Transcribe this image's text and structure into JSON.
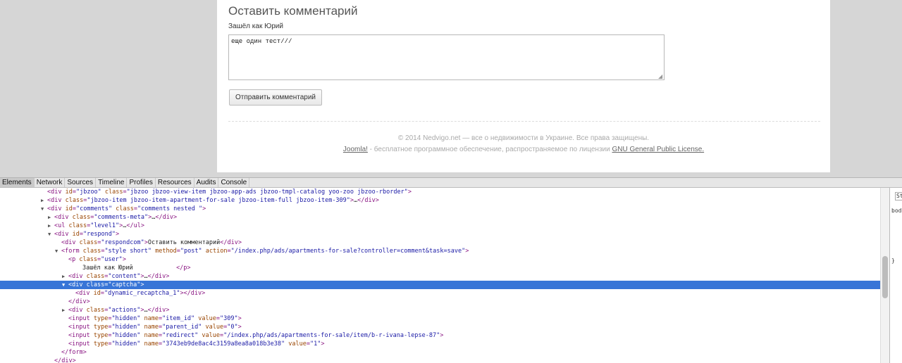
{
  "page": {
    "comment_title": "Оставить комментарий",
    "logged_as": "Зашёл как Юрий",
    "comment_text": "еще один тест///",
    "submit_label": "Отправить комментарий",
    "copyright": "© 2014 Nedvigo.net — все о недвижимости в Украине. Все права защищены.",
    "license_link_joomla": "Joomla!",
    "license_middle": " - бесплатное программное обеспечение, распространяемое по лицензии ",
    "license_link_gnu": "GNU General Public License."
  },
  "devtools": {
    "tabs": [
      "Elements",
      "Network",
      "Sources",
      "Timeline",
      "Profiles",
      "Resources",
      "Audits",
      "Console"
    ],
    "active_tab": "Elements",
    "lines": [
      {
        "indent": 6,
        "tri": "",
        "html": "<div id=\"jbzoo\" class=\"jbzoo jbzoo-view-item jbzoo-app-ads jbzoo-tmpl-catalog yoo-zoo jbzoo-rborder\">",
        "cut": true
      },
      {
        "indent": 6,
        "tri": "▶",
        "html": "<div class=\"jbzoo-item jbzoo-item-apartment-for-sale jbzoo-item-full jbzoo-item-309\">…</div>"
      },
      {
        "indent": 6,
        "tri": "▼",
        "html": "<div id=\"comments\" class=\"comments nested \">"
      },
      {
        "indent": 7,
        "tri": "▶",
        "html": "<div class=\"comments-meta\">…</div>"
      },
      {
        "indent": 7,
        "tri": "▶",
        "html": "<ul class=\"level1\">…</ul>"
      },
      {
        "indent": 7,
        "tri": "▼",
        "html": "<div id=\"respond\">"
      },
      {
        "indent": 8,
        "tri": "",
        "html": "<div class=\"respondcom\">Оставить комментарий</div>"
      },
      {
        "indent": 8,
        "tri": "▼",
        "html": "<form class=\"style short\" method=\"post\" action=\"/index.php/ads/apartments-for-sale?controller=comment&task=save\">"
      },
      {
        "indent": 9,
        "tri": "",
        "html": "<p class=\"user\">"
      },
      {
        "indent": 11,
        "tri": "",
        "html": "Зашёл как Юрий            </p>"
      },
      {
        "indent": 9,
        "tri": "▶",
        "html": "<div class=\"content\">…</div>"
      },
      {
        "indent": 9,
        "tri": "▼",
        "html": "<div class=\"captcha\">",
        "selected": true
      },
      {
        "indent": 10,
        "tri": "",
        "html": "<div id=\"dynamic_recaptcha_1\"></div>"
      },
      {
        "indent": 9,
        "tri": "",
        "html": "</div>"
      },
      {
        "indent": 9,
        "tri": "▶",
        "html": "<div class=\"actions\">…</div>"
      },
      {
        "indent": 9,
        "tri": "",
        "html": "<input type=\"hidden\" name=\"item_id\" value=\"309\">"
      },
      {
        "indent": 9,
        "tri": "",
        "html": "<input type=\"hidden\" name=\"parent_id\" value=\"0\">"
      },
      {
        "indent": 9,
        "tri": "",
        "html": "<input type=\"hidden\" name=\"redirect\" value=\"/index.php/ads/apartments-for-sale/item/b-r-ivana-lepse-87\">"
      },
      {
        "indent": 9,
        "tri": "",
        "html": "<input type=\"hidden\" name=\"3743eb9de8ac4c3159a8ea8a018b3e38\" value=\"1\">"
      },
      {
        "indent": 8,
        "tri": "",
        "html": "</form>"
      },
      {
        "indent": 7,
        "tri": "",
        "html": "</div>"
      }
    ],
    "styles_snippet": [
      "St",
      "bod",
      "}"
    ]
  }
}
